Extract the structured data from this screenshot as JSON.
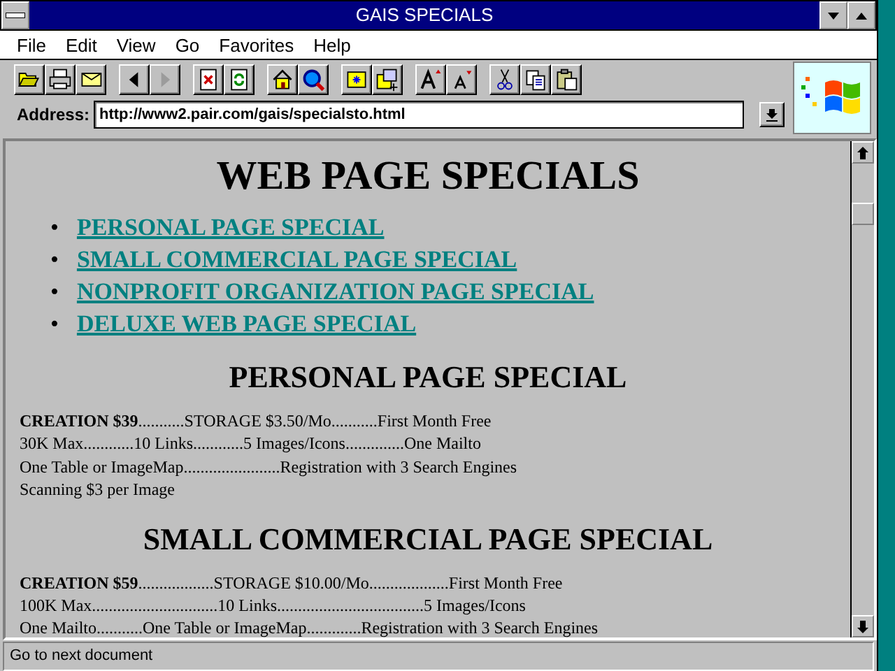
{
  "window": {
    "title": "GAIS SPECIALS"
  },
  "menu": [
    "File",
    "Edit",
    "View",
    "Go",
    "Favorites",
    "Help"
  ],
  "toolbar": [
    [
      {
        "kind": "open",
        "disabled": false
      },
      {
        "kind": "print",
        "disabled": false
      },
      {
        "kind": "mail",
        "disabled": false
      }
    ],
    [
      {
        "kind": "back",
        "disabled": false
      },
      {
        "kind": "forward",
        "disabled": true
      }
    ],
    [
      {
        "kind": "stop",
        "disabled": false
      },
      {
        "kind": "refresh",
        "disabled": false
      }
    ],
    [
      {
        "kind": "home",
        "disabled": false
      },
      {
        "kind": "search",
        "disabled": false
      }
    ],
    [
      {
        "kind": "favorites",
        "disabled": false
      },
      {
        "kind": "add-favorite",
        "disabled": false
      }
    ],
    [
      {
        "kind": "font-larger",
        "disabled": false
      },
      {
        "kind": "font-smaller",
        "disabled": false
      }
    ],
    [
      {
        "kind": "cut",
        "disabled": false
      },
      {
        "kind": "copy",
        "disabled": false
      },
      {
        "kind": "paste",
        "disabled": false
      }
    ]
  ],
  "address": {
    "label": "Address:",
    "value": "http://www2.pair.com/gais/specialsto.html"
  },
  "page": {
    "heading": "WEB PAGE SPECIALS",
    "links": [
      {
        "bullet": "•",
        "text": "PERSONAL PAGE SPECIAL"
      },
      {
        "bullet": "•",
        "text": "SMALL COMMERCIAL PAGE SPECIAL"
      },
      {
        "bullet": "•",
        "text": "NONPROFIT ORGANIZATION PAGE SPECIAL"
      },
      {
        "bullet": "•",
        "text": "DELUXE WEB PAGE SPECIAL"
      }
    ],
    "sections": [
      {
        "heading": "PERSONAL PAGE SPECIAL",
        "lines": [
          "**CREATION $39**...........STORAGE $3.50/Mo...........First Month Free",
          "30K Max............10 Links............5 Images/Icons..............One Mailto",
          "One Table or ImageMap.......................Registration with 3 Search Engines",
          "Scanning $3 per Image"
        ]
      },
      {
        "heading": "SMALL COMMERCIAL PAGE SPECIAL",
        "lines": [
          "**CREATION $59**..................STORAGE $10.00/Mo...................First Month Free",
          "100K Max..............................10 Links...................................5 Images/Icons",
          "One Mailto...........One Table or ImageMap.............Registration with 3 Search Engines"
        ]
      }
    ]
  },
  "status_bar": {
    "text": "Go to next document"
  }
}
